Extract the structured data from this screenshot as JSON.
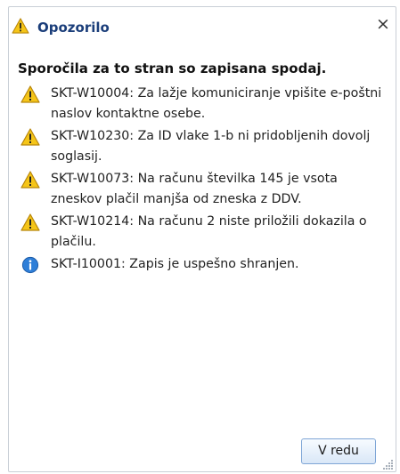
{
  "dialog": {
    "title": "Opozorilo",
    "title_icon": "warning-icon",
    "close_icon": "close-icon",
    "close_label": "×",
    "heading": "Sporočila za to stran so zapisana spodaj.",
    "messages": [
      {
        "type": "warning",
        "icon": "warning-icon",
        "text": "SKT-W10004: Za lažje komuniciranje vpišite e-poštni naslov kontaktne osebe."
      },
      {
        "type": "warning",
        "icon": "warning-icon",
        "text": "SKT-W10230: Za ID vlake 1-b ni pridobljenih dovolj soglasij."
      },
      {
        "type": "warning",
        "icon": "warning-icon",
        "text": "SKT-W10073: Na računu številka 145 je vsota zneskov plačil manjša od zneska z DDV."
      },
      {
        "type": "warning",
        "icon": "warning-icon",
        "text": "SKT-W10214: Na računu 2 niste priložili dokazila o plačilu."
      },
      {
        "type": "info",
        "icon": "info-icon",
        "text": "SKT-I10001: Zapis je uspešno shranjen."
      }
    ],
    "ok_label": "V redu",
    "colors": {
      "title": "#1b3e7a",
      "warning": "#f5c518",
      "info": "#2f7fd8",
      "button_border": "#7fa6d6"
    }
  }
}
